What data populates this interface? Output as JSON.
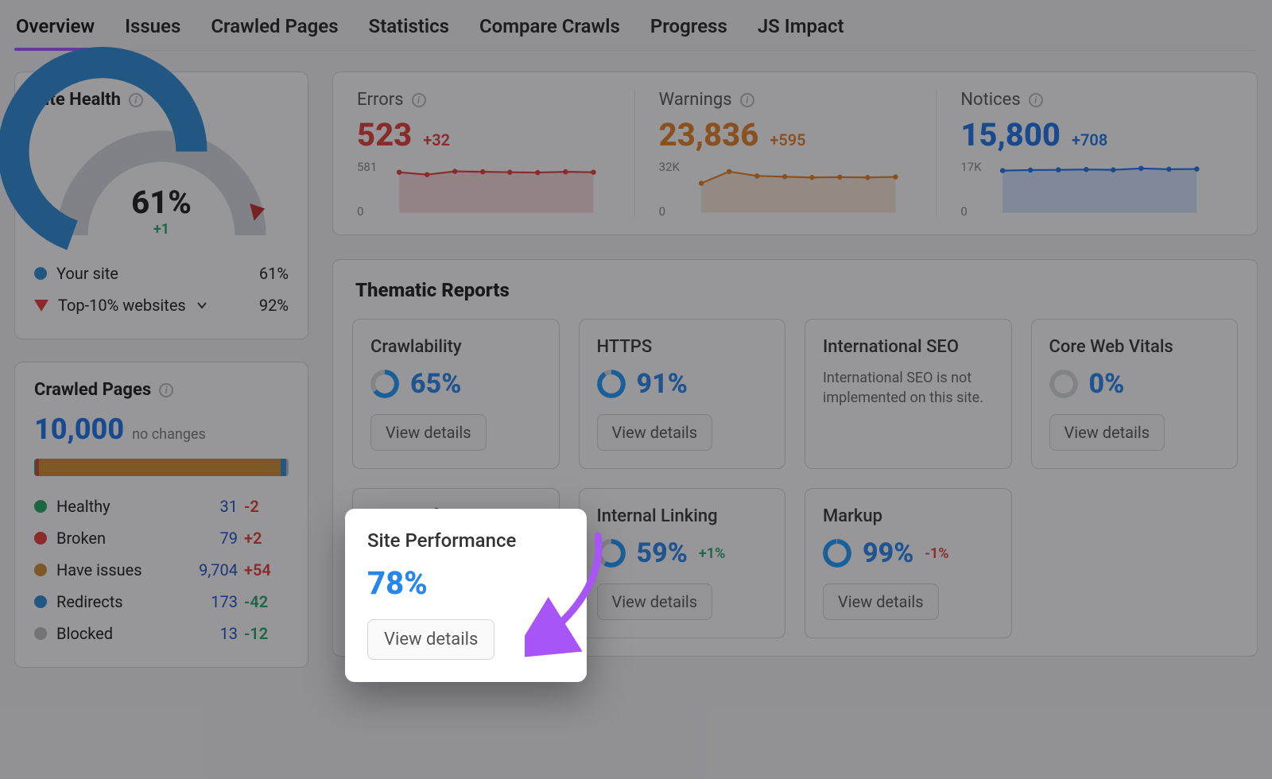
{
  "tabs": [
    "Overview",
    "Issues",
    "Crawled Pages",
    "Statistics",
    "Compare Crawls",
    "Progress",
    "JS Impact"
  ],
  "active_tab": 0,
  "site_health": {
    "title": "Site Health",
    "value": "61%",
    "delta": "+1",
    "legend": {
      "your_site_label": "Your site",
      "your_site_value": "61%",
      "top10_label": "Top-10% websites",
      "top10_value": "92%"
    },
    "gauge_pct": 61,
    "top10_pct": 92
  },
  "crawled_pages": {
    "title": "Crawled Pages",
    "total": "10,000",
    "note": "no changes",
    "bar_segments": [
      {
        "key": "healthy",
        "pct": 0.6,
        "color": "#21a562"
      },
      {
        "key": "broken",
        "pct": 1.2,
        "color": "#e53935"
      },
      {
        "key": "have_issues",
        "pct": 95.0,
        "color": "#d28a2c"
      },
      {
        "key": "redirects",
        "pct": 2.2,
        "color": "#2b8ad6"
      },
      {
        "key": "blocked",
        "pct": 1.0,
        "color": "#bdbdbd"
      }
    ],
    "rows": [
      {
        "label": "Healthy",
        "value": "31",
        "delta": "-2",
        "delta_cls": "neg",
        "color": "#21a562"
      },
      {
        "label": "Broken",
        "value": "79",
        "delta": "+2",
        "delta_cls": "posred",
        "color": "#e53935"
      },
      {
        "label": "Have issues",
        "value": "9,704",
        "delta": "+54",
        "delta_cls": "posred",
        "color": "#d28a2c"
      },
      {
        "label": "Redirects",
        "value": "173",
        "delta": "-42",
        "delta_cls": "pos",
        "color": "#2b8ad6"
      },
      {
        "label": "Blocked",
        "value": "13",
        "delta": "-12",
        "delta_cls": "pos",
        "color": "#bdbdbd"
      }
    ]
  },
  "metrics": {
    "errors": {
      "title": "Errors",
      "value": "523",
      "delta": "+32",
      "color": "#e53935",
      "y_top": "581",
      "y_bot": "0"
    },
    "warnings": {
      "title": "Warnings",
      "value": "23,836",
      "delta": "+595",
      "color": "#e67e22",
      "y_top": "32K",
      "y_bot": "0"
    },
    "notices": {
      "title": "Notices",
      "value": "15,800",
      "delta": "+708",
      "color": "#1a73e8",
      "y_top": "17K",
      "y_bot": "0"
    }
  },
  "thematic": {
    "title": "Thematic Reports",
    "tiles": [
      {
        "title": "Crawlability",
        "pct": "65%",
        "pct_num": 65,
        "btn": "View details"
      },
      {
        "title": "HTTPS",
        "pct": "91%",
        "pct_num": 91,
        "btn": "View details"
      },
      {
        "title": "International SEO",
        "desc": "International SEO is not implemented on this site."
      },
      {
        "title": "Core Web Vitals",
        "pct": "0%",
        "pct_num": 0,
        "btn": "View details"
      },
      {
        "title": "Site Performance",
        "pct": "78%",
        "pct_num": 78,
        "btn": "View details"
      },
      {
        "title": "Internal Linking",
        "pct": "59%",
        "pct_num": 59,
        "delta": "+1%",
        "delta_cls": "pos",
        "btn": "View details"
      },
      {
        "title": "Markup",
        "pct": "99%",
        "pct_num": 99,
        "delta": "-1%",
        "delta_cls": "neg",
        "btn": "View details"
      }
    ]
  },
  "spotlight": {
    "title": "Site Performance",
    "pct": "78%",
    "pct_num": 78,
    "btn": "View details"
  },
  "chart_data": [
    {
      "type": "line",
      "title": "Errors",
      "ylim": [
        0,
        581
      ],
      "x": [
        1,
        2,
        3,
        4,
        5,
        6,
        7,
        8
      ],
      "values": [
        500,
        470,
        510,
        505,
        500,
        495,
        505,
        500
      ],
      "color": "#e53935"
    },
    {
      "type": "line",
      "title": "Warnings",
      "ylim": [
        0,
        32000
      ],
      "x": [
        1,
        2,
        3,
        4,
        5,
        6,
        7,
        8
      ],
      "values": [
        20000,
        28000,
        25000,
        24500,
        24000,
        24200,
        24000,
        24300
      ],
      "color": "#e67e22"
    },
    {
      "type": "line",
      "title": "Notices",
      "ylim": [
        0,
        17000
      ],
      "x": [
        1,
        2,
        3,
        4,
        5,
        6,
        7,
        8
      ],
      "values": [
        15200,
        15400,
        15500,
        15600,
        15500,
        16000,
        15700,
        15800
      ],
      "color": "#1a73e8"
    }
  ]
}
